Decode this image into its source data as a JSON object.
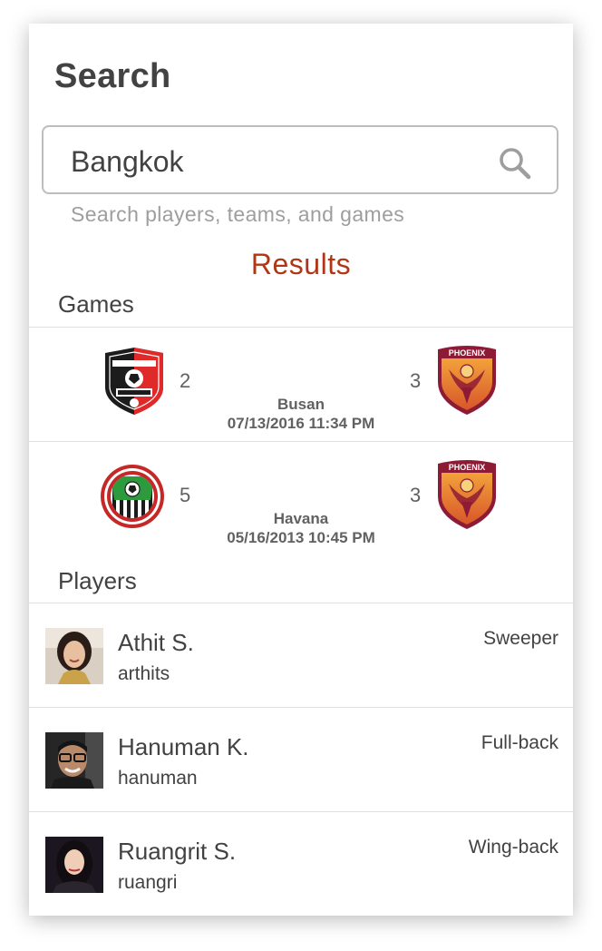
{
  "header": {
    "title": "Search"
  },
  "search": {
    "value": "Bangkok",
    "hint": "Search players, teams, and games"
  },
  "results": {
    "title": "Results",
    "games_title": "Games",
    "players_title": "Players"
  },
  "games": [
    {
      "home": {
        "logo": "fleury-crest",
        "score": "2"
      },
      "away": {
        "logo": "phoenix-crest",
        "score": "3"
      },
      "location": "Busan",
      "datetime": "07/13/2016 11:34 PM"
    },
    {
      "home": {
        "logo": "green-striped-club-crest",
        "score": "5"
      },
      "away": {
        "logo": "phoenix-crest",
        "score": "3"
      },
      "location": "Havana",
      "datetime": "05/16/2013 10:45 PM"
    }
  ],
  "players": [
    {
      "name": "Athit S.",
      "handle": "arthits",
      "position": "Sweeper"
    },
    {
      "name": "Hanuman K.",
      "handle": "hanuman",
      "position": "Full-back"
    },
    {
      "name": "Ruangrit S.",
      "handle": "ruangri",
      "position": "Wing-back"
    }
  ],
  "colors": {
    "accent": "#b23616",
    "text": "#424242",
    "hint": "#9e9e9e",
    "divider": "#e0e0e0"
  }
}
